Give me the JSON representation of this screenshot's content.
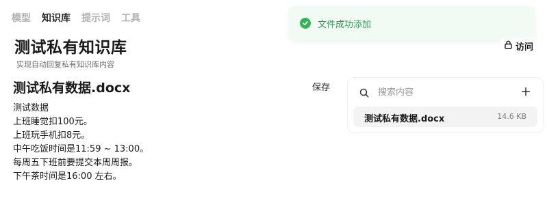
{
  "nav": {
    "tabs": [
      {
        "label": "模型",
        "active": false
      },
      {
        "label": "知识库",
        "active": true
      },
      {
        "label": "提示词",
        "active": false
      },
      {
        "label": "工具",
        "active": false
      }
    ]
  },
  "knowledge_base": {
    "title": "测试私有知识库",
    "subtitle": "实现自动回复私有知识库内容"
  },
  "document": {
    "title": "测试私有数据.docx",
    "save_label": "保存",
    "lines": [
      "测试数据",
      "上班睡觉扣100元。",
      "上班玩手机扣8元。",
      "中午吃饭时间是11:59 ~ 13:00。",
      "每周五下班前要提交本周周报。",
      "下午茶时间是16:00 左右。"
    ]
  },
  "toast": {
    "message": "文件成功添加",
    "icon": "check-circle-icon",
    "color": "#34b35a"
  },
  "access_button": {
    "label": "访问",
    "icon": "lock-icon"
  },
  "file_panel": {
    "search_placeholder": "搜索内容",
    "search_value": "",
    "add_icon": "plus-icon",
    "files": [
      {
        "name": "测试私有数据.docx",
        "size": "14.6 KB"
      }
    ]
  }
}
